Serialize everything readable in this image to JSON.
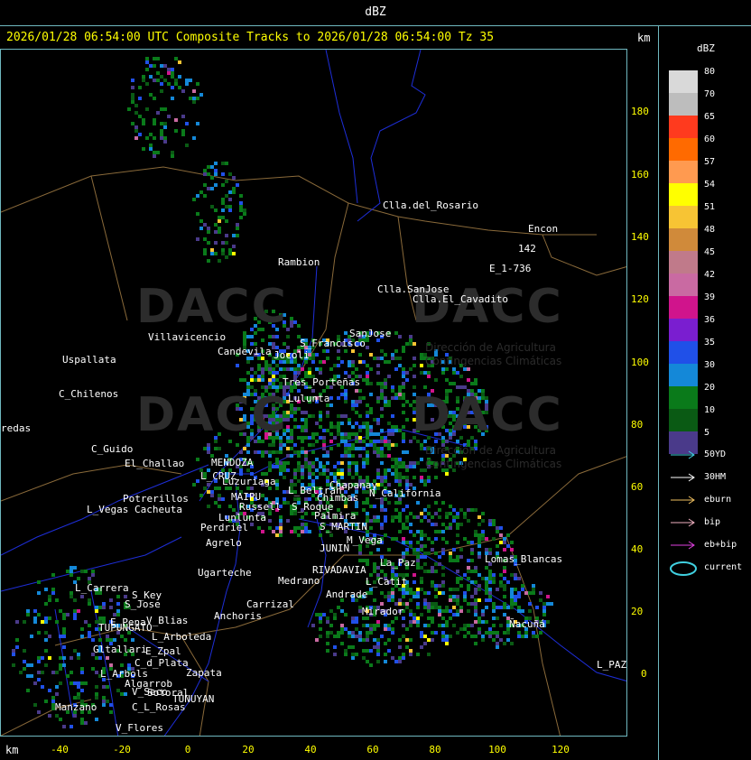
{
  "window_title": "dBZ",
  "header_text": "2026/01/28 06:54:00 UTC Composite Tracks to 2026/01/28 06:54:00 Tz 35",
  "km_label": "km",
  "y_ticks": [
    "180",
    "160",
    "140",
    "120",
    "100",
    "80",
    "60",
    "40",
    "20",
    "0"
  ],
  "x_ticks": [
    "-40",
    "-20",
    "0",
    "20",
    "40",
    "60",
    "80",
    "100",
    "120"
  ],
  "legend": {
    "title": "dBZ",
    "levels": [
      {
        "label": "80",
        "color": "#d9d9d9"
      },
      {
        "label": "70",
        "color": "#bdbdbd"
      },
      {
        "label": "65",
        "color": "#ff3a1e"
      },
      {
        "label": "60",
        "color": "#ff6a00"
      },
      {
        "label": "57",
        "color": "#ff9a50"
      },
      {
        "label": "54",
        "color": "#ffff00"
      },
      {
        "label": "51",
        "color": "#f7c434"
      },
      {
        "label": "48",
        "color": "#d08a3a"
      },
      {
        "label": "45",
        "color": "#c07a8a"
      },
      {
        "label": "42",
        "color": "#c96aa2"
      },
      {
        "label": "39",
        "color": "#d0148c"
      },
      {
        "label": "36",
        "color": "#7a1ed0"
      },
      {
        "label": "35",
        "color": "#2050e8"
      },
      {
        "label": "30",
        "color": "#1488d8"
      },
      {
        "label": "20",
        "color": "#0a7a1a"
      },
      {
        "label": "10",
        "color": "#0a5a14"
      },
      {
        "label": "5",
        "color": "#4a3a8a"
      }
    ],
    "tracks": [
      {
        "label": "50YD",
        "color": "#40d0e0"
      },
      {
        "label": "30HM",
        "color": "#ffffff"
      },
      {
        "label": "eburn",
        "color": "#f0c060"
      },
      {
        "label": "bip",
        "color": "#f0b0c0"
      },
      {
        "label": "eb+bip",
        "color": "#e040e0"
      },
      {
        "label": "current",
        "color": "#40d0e0"
      }
    ]
  },
  "watermark": {
    "logo_text": "DACC",
    "subtitle_1": "Dirección de Agricultura",
    "subtitle_2": "Contingencias Climáticas"
  },
  "places": [
    {
      "name": "Clla.del_Rosario"
    },
    {
      "name": "Encon"
    },
    {
      "name": "142"
    },
    {
      "name": "E_1-736"
    },
    {
      "name": "Rambion"
    },
    {
      "name": "Clla.SanJose"
    },
    {
      "name": "Clla.El_Cavadito"
    },
    {
      "name": "SanJose"
    },
    {
      "name": "Villavicencio"
    },
    {
      "name": "Candevila"
    },
    {
      "name": "Jocoli"
    },
    {
      "name": "S_Francisco"
    },
    {
      "name": "Uspallata"
    },
    {
      "name": "C_Chilenos"
    },
    {
      "name": "Tres_Porteñas"
    },
    {
      "name": "Lulunta"
    },
    {
      "name": "redas"
    },
    {
      "name": "C_Guido"
    },
    {
      "name": "El_Challao"
    },
    {
      "name": "MENDOZA"
    },
    {
      "name": "L_CRUZ"
    },
    {
      "name": "Luzuriaga"
    },
    {
      "name": "MAIPU"
    },
    {
      "name": "Russell"
    },
    {
      "name": "Lunlunta"
    },
    {
      "name": "L_Beltran"
    },
    {
      "name": "Chimbas"
    },
    {
      "name": "Chapanay"
    },
    {
      "name": "N_California"
    },
    {
      "name": "Potrerillos"
    },
    {
      "name": "L_Vegas"
    },
    {
      "name": "Cacheuta"
    },
    {
      "name": "Perdriel"
    },
    {
      "name": "S_Roque"
    },
    {
      "name": "Palmira"
    },
    {
      "name": "S_MARTIN"
    },
    {
      "name": "M_Vega"
    },
    {
      "name": "JUNIN"
    },
    {
      "name": "Agrelo"
    },
    {
      "name": "Ugarteche"
    },
    {
      "name": "RIVADAVIA"
    },
    {
      "name": "La_Paz"
    },
    {
      "name": "Lomas_Blancas"
    },
    {
      "name": "Andrade"
    },
    {
      "name": "Medrano"
    },
    {
      "name": "L_Catit"
    },
    {
      "name": "Carrizal"
    },
    {
      "name": "Mirador"
    },
    {
      "name": "L_Carrera"
    },
    {
      "name": "S_Key"
    },
    {
      "name": "S_Jose"
    },
    {
      "name": "Anchoris"
    },
    {
      "name": "V_Blias"
    },
    {
      "name": "E_Pena"
    },
    {
      "name": "TUPUNGATO"
    },
    {
      "name": "L_Arboleda"
    },
    {
      "name": "Gltallari"
    },
    {
      "name": "E_Zpal"
    },
    {
      "name": "C_d_Plata"
    },
    {
      "name": "Zapata"
    },
    {
      "name": "L_Arbols"
    },
    {
      "name": "Algarrob"
    },
    {
      "name": "V_Seco"
    },
    {
      "name": "Sotoral"
    },
    {
      "name": "TUNUYAN"
    },
    {
      "name": "Manzano"
    },
    {
      "name": "C_L_Rosas"
    },
    {
      "name": "V_Flores"
    },
    {
      "name": "Ñacuñá"
    },
    {
      "name": "L_PAZ"
    }
  ]
}
